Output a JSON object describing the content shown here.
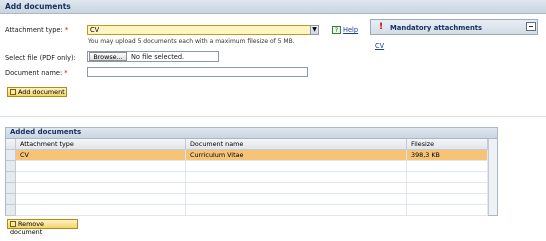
{
  "header": {
    "title": "Add documents"
  },
  "form": {
    "attachment_type_label": "Attachment type:",
    "attachment_type_value": "CV",
    "required_marker": "*",
    "help_link": "Help",
    "upload_hint": "You may upload 5 documents each with a maximum filesize of 5 MB.",
    "select_file_label": "Select file (PDF only):",
    "browse_button": "Browse...",
    "file_status": "No file selected.",
    "document_name_label": "Document name:",
    "document_name_value": "",
    "add_document_button": "Add document"
  },
  "side_panel": {
    "title": "Mandatory attachments",
    "items": [
      "CV"
    ]
  },
  "added_documents": {
    "title": "Added documents",
    "columns": [
      "Attachment type",
      "Document name",
      "Filesize"
    ],
    "rows": [
      {
        "attachment_type": "CV",
        "document_name": "Curriculum Vitae",
        "filesize": "398,3 KB",
        "selected": true
      }
    ],
    "remove_button": "Remove document"
  },
  "colors": {
    "header_text": "#15325e",
    "selected_row": "#f6c377",
    "required": "#cc0000",
    "focused_field": "#fff4c2"
  }
}
